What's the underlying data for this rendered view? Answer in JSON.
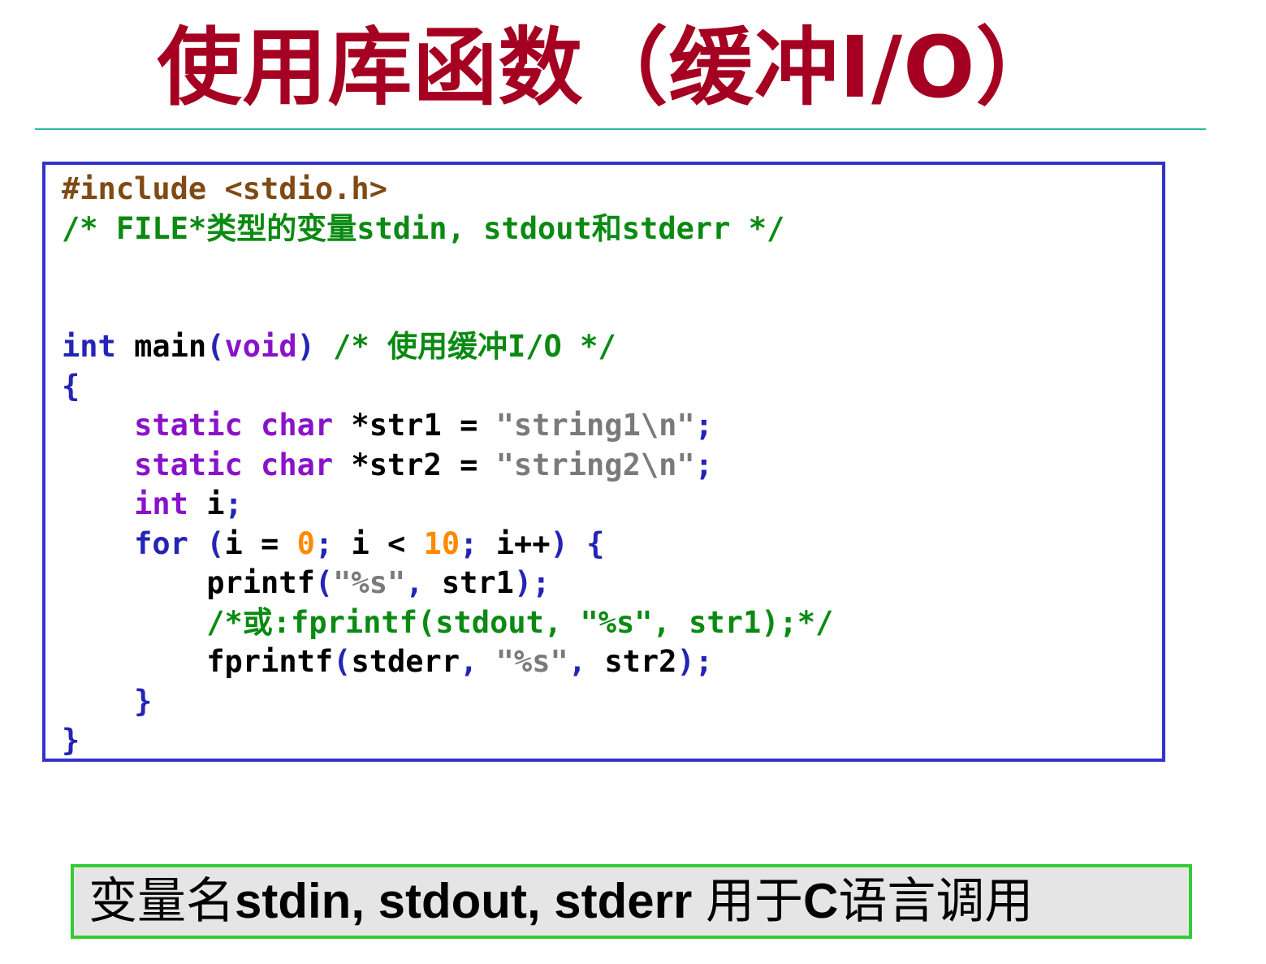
{
  "title": "使用库函数（缓冲I/O）",
  "code": {
    "lines": [
      [
        {
          "t": "#include <stdio.h>",
          "c": "pp"
        }
      ],
      [
        {
          "t": "/* FILE*类型的变量stdin, stdout和stderr */",
          "c": "cm"
        }
      ],
      [],
      [],
      [
        {
          "t": "int",
          "c": "kw"
        },
        {
          "t": " main",
          "c": "plain"
        },
        {
          "t": "(",
          "c": "kw"
        },
        {
          "t": "void",
          "c": "kw2"
        },
        {
          "t": ") ",
          "c": "kw"
        },
        {
          "t": "/* 使用缓冲I/O */",
          "c": "cm"
        }
      ],
      [
        {
          "t": "{",
          "c": "kw"
        }
      ],
      [
        {
          "t": "    ",
          "c": "plain"
        },
        {
          "t": "static",
          "c": "kw2"
        },
        {
          "t": " ",
          "c": "plain"
        },
        {
          "t": "char",
          "c": "kw2"
        },
        {
          "t": " *str1 = ",
          "c": "plain"
        },
        {
          "t": "\"string1\\n\"",
          "c": "str"
        },
        {
          "t": ";",
          "c": "kw"
        }
      ],
      [
        {
          "t": "    ",
          "c": "plain"
        },
        {
          "t": "static",
          "c": "kw2"
        },
        {
          "t": " ",
          "c": "plain"
        },
        {
          "t": "char",
          "c": "kw2"
        },
        {
          "t": " *str2 = ",
          "c": "plain"
        },
        {
          "t": "\"string2\\n\"",
          "c": "str"
        },
        {
          "t": ";",
          "c": "kw"
        }
      ],
      [
        {
          "t": "    ",
          "c": "plain"
        },
        {
          "t": "int",
          "c": "kw2"
        },
        {
          "t": " i",
          "c": "plain"
        },
        {
          "t": ";",
          "c": "kw"
        }
      ],
      [
        {
          "t": "    ",
          "c": "plain"
        },
        {
          "t": "for",
          "c": "kw"
        },
        {
          "t": " (",
          "c": "kw"
        },
        {
          "t": "i = ",
          "c": "plain"
        },
        {
          "t": "0",
          "c": "num"
        },
        {
          "t": "; ",
          "c": "kw"
        },
        {
          "t": "i < ",
          "c": "plain"
        },
        {
          "t": "10",
          "c": "num"
        },
        {
          "t": "; ",
          "c": "kw"
        },
        {
          "t": "i++",
          "c": "plain"
        },
        {
          "t": ") {",
          "c": "kw"
        }
      ],
      [
        {
          "t": "        ",
          "c": "plain"
        },
        {
          "t": "printf",
          "c": "plain"
        },
        {
          "t": "(",
          "c": "kw"
        },
        {
          "t": "\"%s\"",
          "c": "str"
        },
        {
          "t": ", ",
          "c": "kw"
        },
        {
          "t": "str1",
          "c": "plain"
        },
        {
          "t": ");",
          "c": "kw"
        }
      ],
      [
        {
          "t": "        ",
          "c": "plain"
        },
        {
          "t": "/*或:fprintf(stdout, \"%s\", str1);*/",
          "c": "cm"
        }
      ],
      [
        {
          "t": "        ",
          "c": "plain"
        },
        {
          "t": "fprintf",
          "c": "plain"
        },
        {
          "t": "(",
          "c": "kw"
        },
        {
          "t": "stderr",
          "c": "plain"
        },
        {
          "t": ", ",
          "c": "kw"
        },
        {
          "t": "\"%s\"",
          "c": "str"
        },
        {
          "t": ", ",
          "c": "kw"
        },
        {
          "t": "str2",
          "c": "plain"
        },
        {
          "t": ");",
          "c": "kw"
        }
      ],
      [
        {
          "t": "    ",
          "c": "plain"
        },
        {
          "t": "}",
          "c": "kw"
        }
      ],
      [
        {
          "t": "}",
          "c": "kw"
        }
      ]
    ]
  },
  "note": {
    "part1": "变量名",
    "part2": "stdin, stdout, stderr",
    "part3": " 用于",
    "part4": "C",
    "part5": "语言调用"
  },
  "colors": {
    "title": "#a50021",
    "rule": "#2eb8a5",
    "code_border": "#3333cc",
    "note_border": "#33cc33",
    "note_background": "#e5e5e5",
    "preprocessor": "#7f4a14",
    "comment": "#0a8a12",
    "keyword": "#2424b5",
    "type_keyword": "#8a12c9",
    "string": "#7a7a7a",
    "number": "#ff8a00"
  }
}
